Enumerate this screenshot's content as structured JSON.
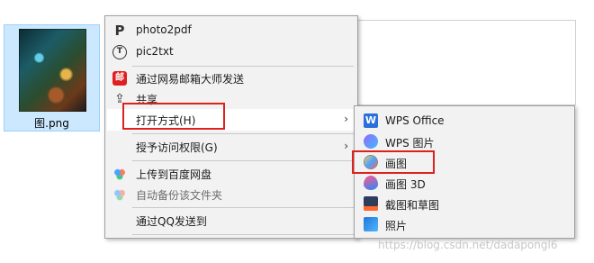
{
  "file": {
    "name": "图.png",
    "icon": "image-thumbnail"
  },
  "context_menu": {
    "items": [
      {
        "label": "photo2pdf",
        "icon": "photo2pdf-icon"
      },
      {
        "label": "pic2txt",
        "icon": "pic2txt-icon"
      },
      {
        "label": "通过网易邮箱大师发送",
        "icon": "netease-mail-icon"
      },
      {
        "label": "共享",
        "icon": "share-icon"
      },
      {
        "label": "打开方式(H)",
        "icon": "",
        "has_submenu": true
      },
      {
        "label": "授予访问权限(G)",
        "icon": "",
        "has_submenu": true
      },
      {
        "label": "上传到百度网盘",
        "icon": "baidu-netdisk-icon"
      },
      {
        "label": "自动备份该文件夹",
        "icon": "baidu-netdisk-icon",
        "disabled": true
      },
      {
        "label": "通过QQ发送到",
        "icon": ""
      }
    ],
    "arrow_glyph": "›"
  },
  "open_with_submenu": {
    "items": [
      {
        "label": "WPS Office",
        "icon": "wps-office-icon"
      },
      {
        "label": "WPS 图片",
        "icon": "wps-picture-icon"
      },
      {
        "label": "画图",
        "icon": "paint-icon"
      },
      {
        "label": "画图 3D",
        "icon": "paint-3d-icon"
      },
      {
        "label": "截图和草图",
        "icon": "snip-sketch-icon"
      },
      {
        "label": "照片",
        "icon": "photos-icon"
      }
    ]
  },
  "icon_glyphs": {
    "photo2pdf": "P",
    "pic2txt": "Ⓣ",
    "mail": "邮",
    "share": "⇪",
    "wps": "W"
  },
  "highlight_color": "#e0201a",
  "watermark": "https://blog.csdn.net/dadapongl6"
}
